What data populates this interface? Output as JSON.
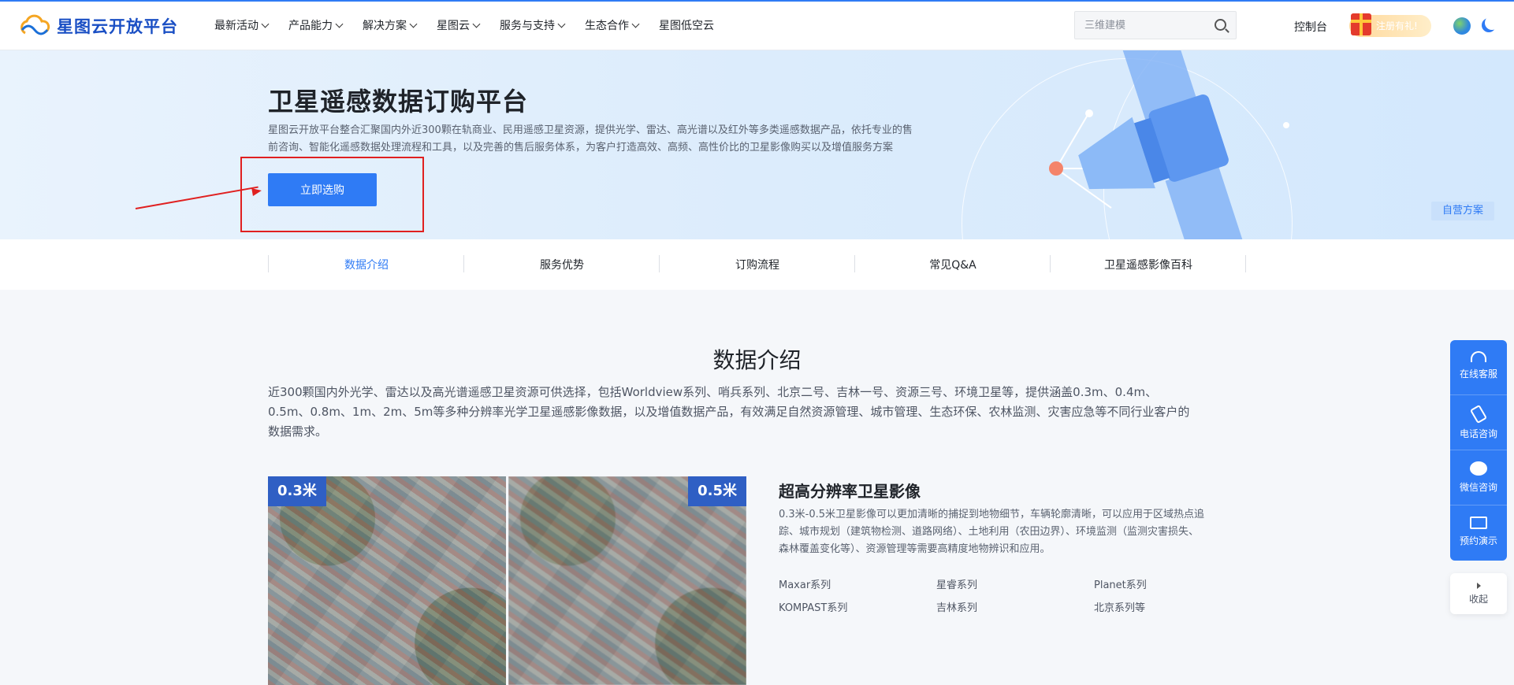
{
  "header": {
    "logo_text": "星图云开放平台",
    "nav": [
      {
        "label": "最新活动",
        "dropdown": true
      },
      {
        "label": "产品能力",
        "dropdown": true
      },
      {
        "label": "解决方案",
        "dropdown": true
      },
      {
        "label": "星图云",
        "dropdown": true
      },
      {
        "label": "服务与支持",
        "dropdown": true
      },
      {
        "label": "生态合作",
        "dropdown": true
      },
      {
        "label": "星图低空云",
        "dropdown": false
      }
    ],
    "search_placeholder": "三维建模",
    "console_label": "控制台",
    "gift_label": "注册有礼!"
  },
  "banner": {
    "title": "卫星遥感数据订购平台",
    "desc_line1": "星图云开放平台整合汇聚国内外近300颗在轨商业、民用遥感卫星资源，提供光学、雷达、高光谱以及红外等多类遥感数据产品，依托专业的售",
    "desc_line2": "前咨询、智能化遥感数据处理流程和工具，以及完善的售后服务体系，为客户打造高效、高频、高性价比的卫星影像购买以及增值服务方案",
    "buy_button": "立即选购",
    "self_tag": "自营方案"
  },
  "tabs": [
    "数据介绍",
    "服务优势",
    "订购流程",
    "常见Q&A",
    "卫星遥感影像百科"
  ],
  "intro": {
    "title": "数据介绍",
    "desc_line1": "近300颗国内外光学、雷达以及高光谱遥感卫星资源可供选择，包括Worldview系列、哨兵系列、北京二号、吉林一号、资源三号、环境卫星等，提供涵盖0.3m、0.4m、",
    "desc_line2": "0.5m、0.8m、1m、2m、5m等多种分辨率光学卫星遥感影像数据，以及增值数据产品，有效满足自然资源管理、城市管理、生态环保、农林监测、灾害应急等不同行业客户的",
    "desc_line3": "数据需求。",
    "img_left_tag": "0.3米",
    "img_right_tag": "0.5米",
    "feature_title": "超高分辨率卫星影像",
    "feature_desc_line1": "0.3米-0.5米卫星影像可以更加清晰的捕捉到地物细节，车辆轮廓清晰，可以应用于区域热点追",
    "feature_desc_line2": "踪、城市规划（建筑物检测、道路网络）、土地利用（农田边界）、环境监测（监测灾害损失、",
    "feature_desc_line3": "森林覆盖变化等）、资源管理等需要高精度地物辨识和应用。",
    "series": [
      "Maxar系列",
      "星睿系列",
      "Planet系列",
      "KOMPAST系列",
      "吉林系列",
      "北京系列等"
    ]
  },
  "float_bar": {
    "items": [
      "在线客服",
      "电话咨询",
      "微信咨询",
      "预约演示"
    ],
    "collapse": "收起"
  }
}
